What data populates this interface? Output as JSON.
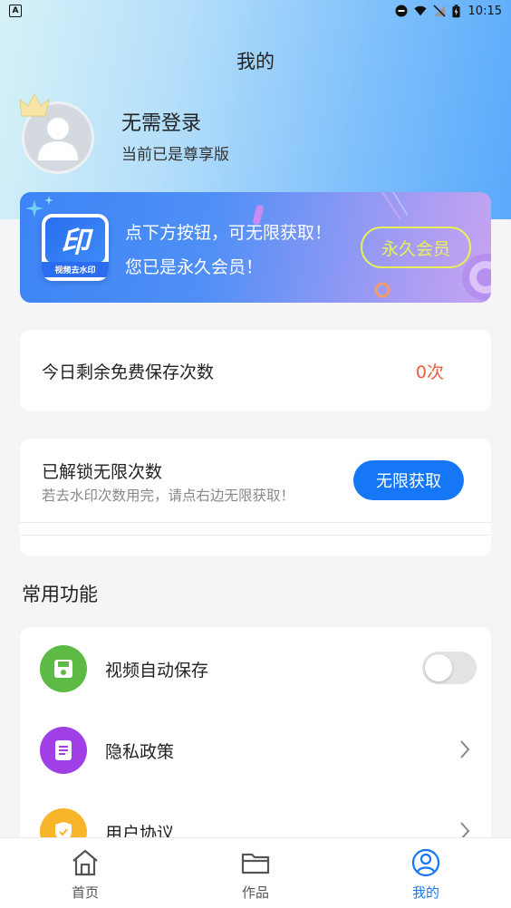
{
  "status_bar": {
    "time": "10:15",
    "left_glyph": "A"
  },
  "page": {
    "title": "我的"
  },
  "user": {
    "name": "无需登录",
    "subtitle": "当前已是尊享版"
  },
  "vip_card": {
    "logo_text": "印",
    "logo_caption": "视频去水印",
    "line1": "点下方按钮，可无限获取！",
    "line2": "您已是永久会员！",
    "badge": "永久会员",
    "badge_color": "#e7f05a"
  },
  "free_saves": {
    "label": "今日剩余免费保存次数",
    "value": "0次",
    "value_color": "#f25a3c"
  },
  "unlock": {
    "title": "已解锁无限次数",
    "subtitle": "若去水印次数用完，请点右边无限获取！",
    "button": "无限获取",
    "accent": "#1677f6"
  },
  "functions": {
    "section_title": "常用功能",
    "items": [
      {
        "label": "视频自动保存",
        "icon": "save-icon",
        "color": "#5dbb45",
        "control": "toggle",
        "toggle_on": false
      },
      {
        "label": "隐私政策",
        "icon": "document-icon",
        "color": "#a03fe6",
        "control": "chevron"
      },
      {
        "label": "用户协议",
        "icon": "shield-check-icon",
        "color": "#f7b52a",
        "control": "chevron"
      }
    ]
  },
  "tabbar": {
    "tabs": [
      {
        "label": "首页",
        "icon": "home-icon",
        "active": false
      },
      {
        "label": "作品",
        "icon": "folder-icon",
        "active": false
      },
      {
        "label": "我的",
        "icon": "user-icon",
        "active": true
      }
    ]
  }
}
